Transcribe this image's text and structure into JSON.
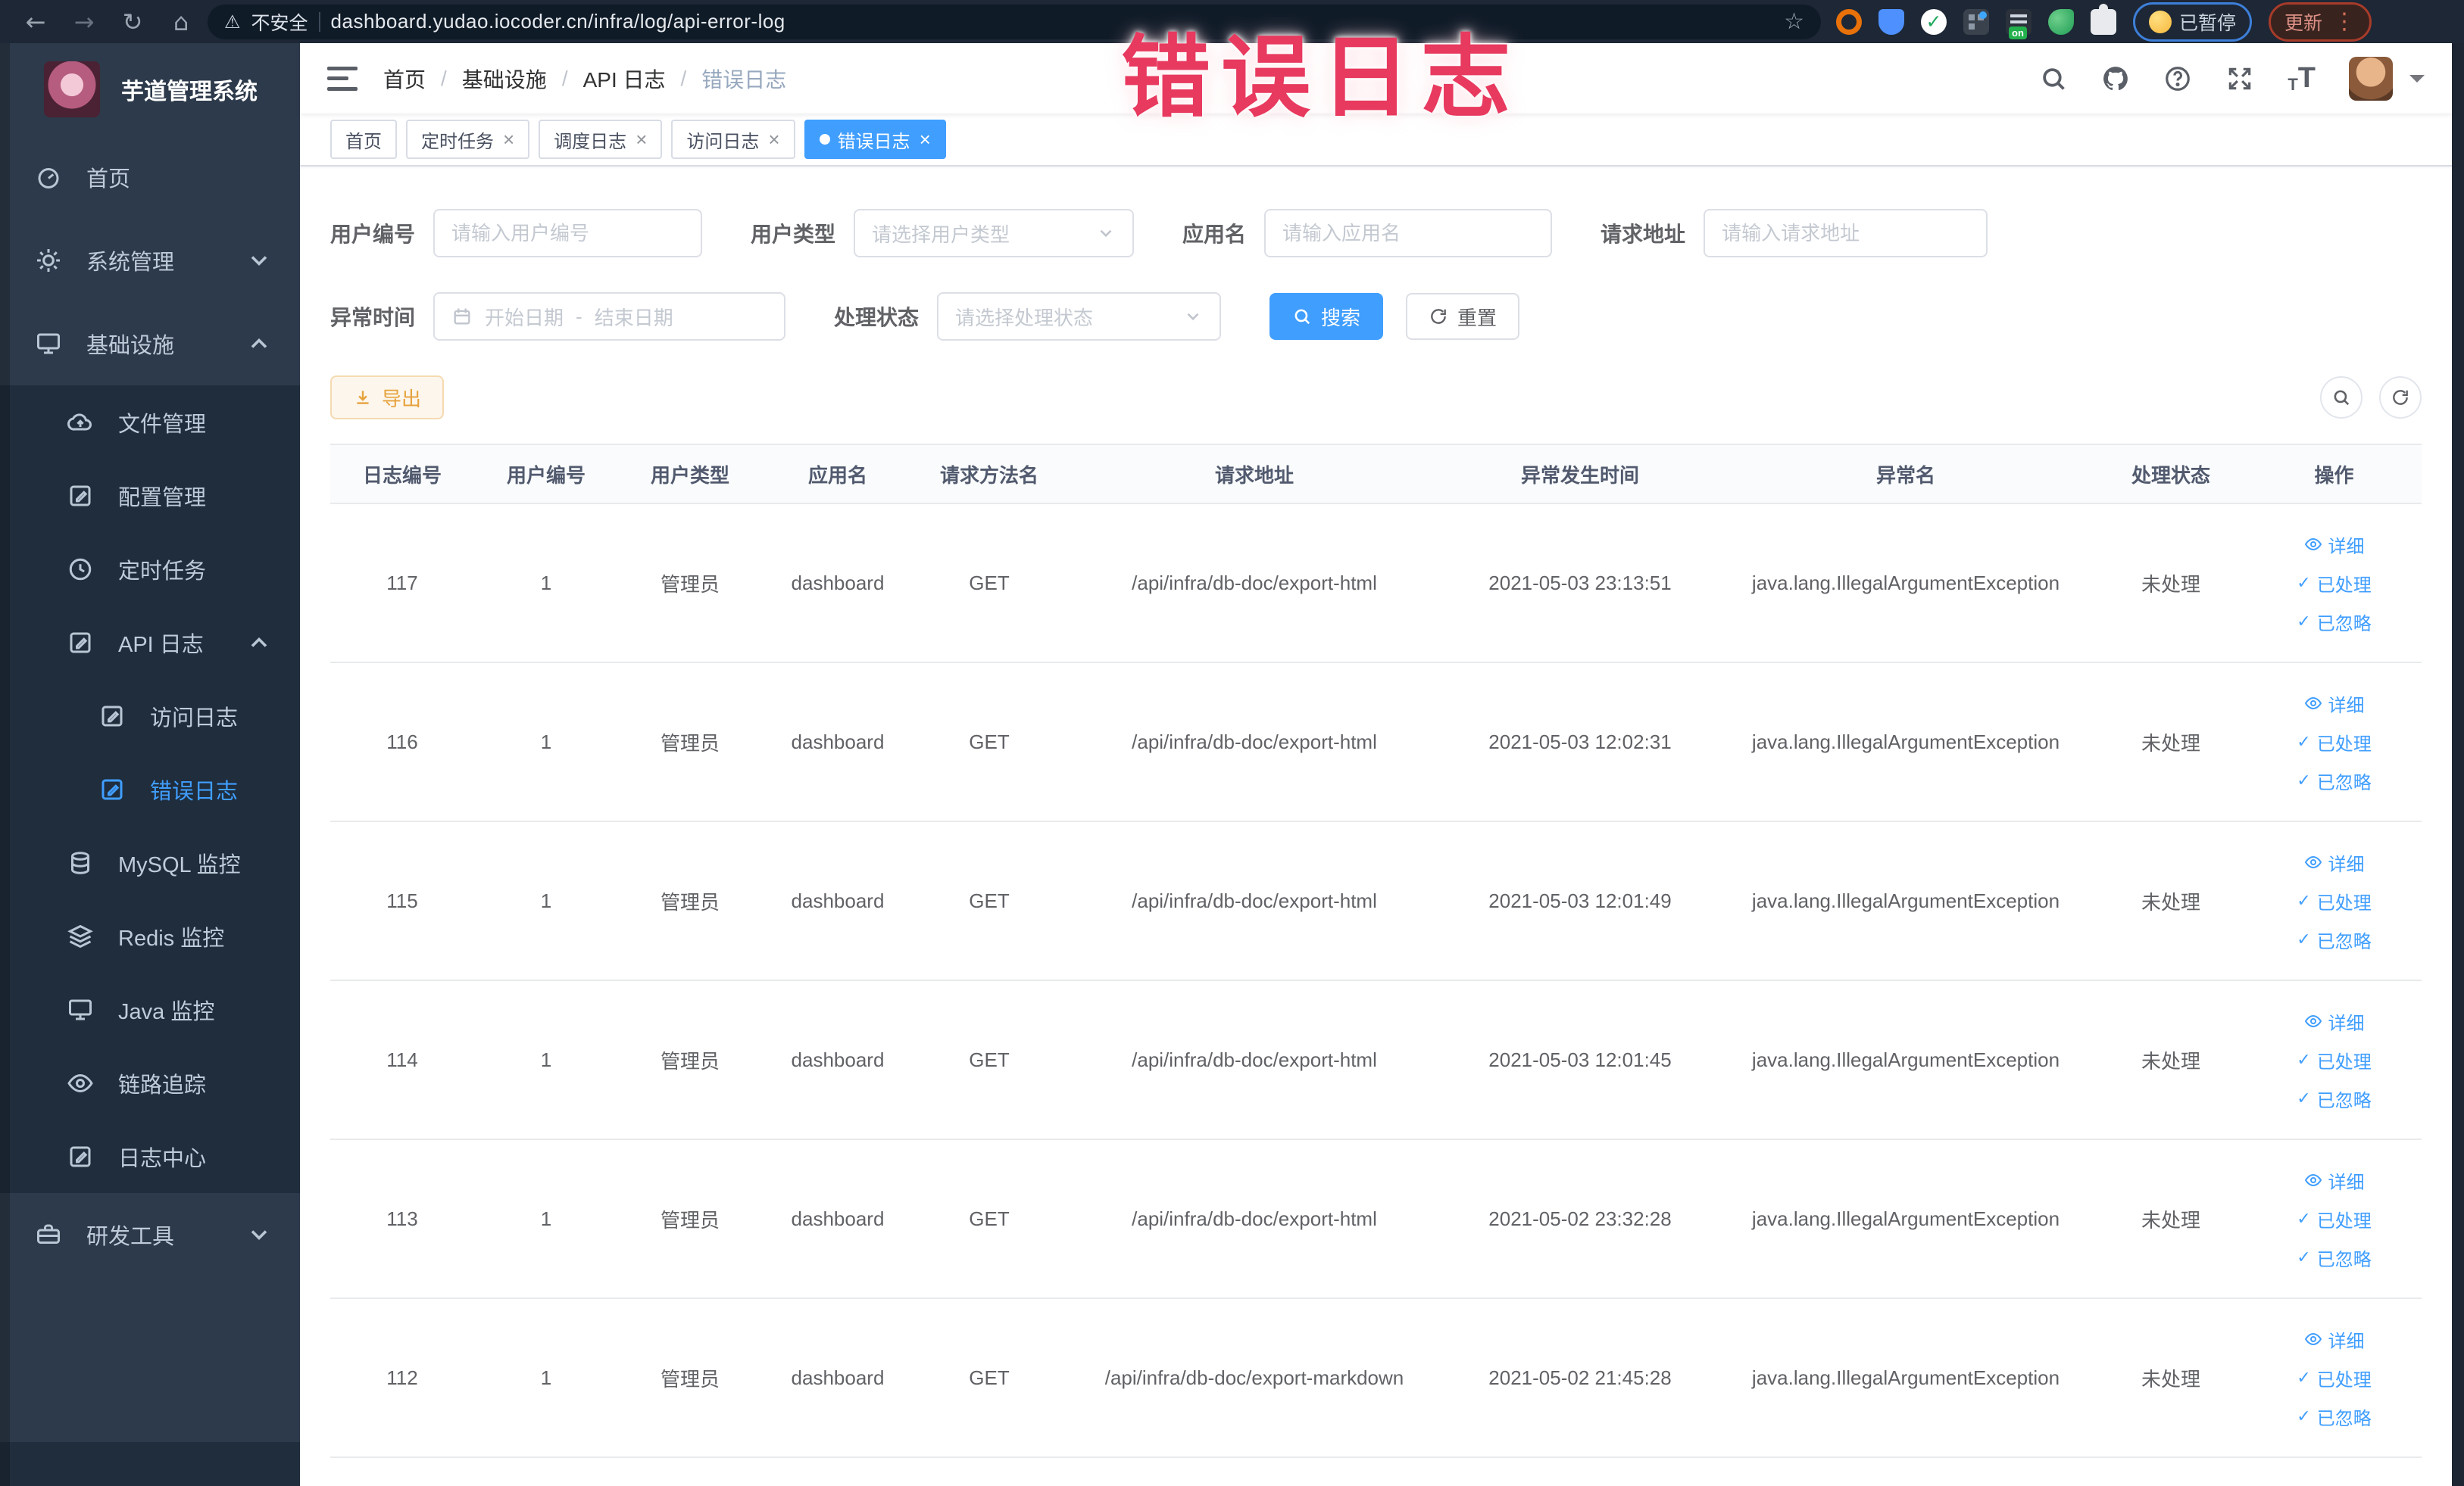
{
  "annotation": {
    "text": "错误日志"
  },
  "browser": {
    "security_label": "不安全",
    "url": "dashboard.yudao.iocoder.cn/infra/log/api-error-log",
    "extension_on_label": "on",
    "paused_badge": "已暂停",
    "update_badge": "更新",
    "icons": [
      "back-icon",
      "forward-icon",
      "refresh-icon",
      "home-icon",
      "warning-icon",
      "bookmark-star-icon",
      "kebab-menu-icon"
    ]
  },
  "sidebar": {
    "app_title": "芋道管理系统",
    "items": [
      {
        "label": "首页",
        "icon": "dashboard-icon"
      },
      {
        "label": "系统管理",
        "icon": "gear-icon",
        "chevron": "down"
      },
      {
        "label": "基础设施",
        "icon": "monitor-icon",
        "chevron": "up"
      },
      {
        "label": "文件管理",
        "icon": "cloud-upload-icon"
      },
      {
        "label": "配置管理",
        "icon": "edit-icon"
      },
      {
        "label": "定时任务",
        "icon": "clock-icon"
      },
      {
        "label": "API 日志",
        "icon": "log-icon",
        "chevron": "up"
      },
      {
        "label": "访问日志",
        "icon": "log-icon"
      },
      {
        "label": "错误日志",
        "icon": "log-icon",
        "active": true
      },
      {
        "label": "MySQL 监控",
        "icon": "database-icon"
      },
      {
        "label": "Redis 监控",
        "icon": "layers-icon"
      },
      {
        "label": "Java 监控",
        "icon": "java-monitor-icon"
      },
      {
        "label": "链路追踪",
        "icon": "eye-icon"
      },
      {
        "label": "日志中心",
        "icon": "log-center-icon"
      },
      {
        "label": "研发工具",
        "icon": "toolbox-icon",
        "chevron": "down"
      }
    ]
  },
  "header": {
    "breadcrumb": [
      "首页",
      "基础设施",
      "API 日志",
      "错误日志"
    ],
    "right_icons": [
      "search-icon",
      "github-icon",
      "help-icon",
      "fullscreen-icon",
      "font-size-icon",
      "avatar",
      "caret-down-icon"
    ]
  },
  "tabs": [
    {
      "label": "首页",
      "closable": false,
      "active": false
    },
    {
      "label": "定时任务",
      "closable": true,
      "active": false
    },
    {
      "label": "调度日志",
      "closable": true,
      "active": false
    },
    {
      "label": "访问日志",
      "closable": true,
      "active": false
    },
    {
      "label": "错误日志",
      "closable": true,
      "active": true
    }
  ],
  "filters": {
    "user_id_label": "用户编号",
    "user_id_placeholder": "请输入用户编号",
    "user_type_label": "用户类型",
    "user_type_placeholder": "请选择用户类型",
    "app_name_label": "应用名",
    "app_name_placeholder": "请输入应用名",
    "request_url_label": "请求地址",
    "request_url_placeholder": "请输入请求地址",
    "exception_time_label": "异常时间",
    "date_start_placeholder": "开始日期",
    "date_separator": "-",
    "date_end_placeholder": "结束日期",
    "process_status_label": "处理状态",
    "process_status_placeholder": "请选择处理状态",
    "search_button": "搜索",
    "reset_button": "重置"
  },
  "toolbar": {
    "export_button": "导出"
  },
  "table": {
    "columns": [
      "日志编号",
      "用户编号",
      "用户类型",
      "应用名",
      "请求方法名",
      "请求地址",
      "异常发生时间",
      "异常名",
      "处理状态",
      "操作"
    ],
    "row_actions": {
      "detail": "详细",
      "processed": "已处理",
      "ignored": "已忽略"
    },
    "rows": [
      {
        "id": "117",
        "user_id": "1",
        "user_type": "管理员",
        "app": "dashboard",
        "method": "GET",
        "url": "/api/infra/db-doc/export-html",
        "time": "2021-05-03 23:13:51",
        "exception": "java.lang.IllegalArgumentException",
        "status": "未处理"
      },
      {
        "id": "116",
        "user_id": "1",
        "user_type": "管理员",
        "app": "dashboard",
        "method": "GET",
        "url": "/api/infra/db-doc/export-html",
        "time": "2021-05-03 12:02:31",
        "exception": "java.lang.IllegalArgumentException",
        "status": "未处理"
      },
      {
        "id": "115",
        "user_id": "1",
        "user_type": "管理员",
        "app": "dashboard",
        "method": "GET",
        "url": "/api/infra/db-doc/export-html",
        "time": "2021-05-03 12:01:49",
        "exception": "java.lang.IllegalArgumentException",
        "status": "未处理"
      },
      {
        "id": "114",
        "user_id": "1",
        "user_type": "管理员",
        "app": "dashboard",
        "method": "GET",
        "url": "/api/infra/db-doc/export-html",
        "time": "2021-05-03 12:01:45",
        "exception": "java.lang.IllegalArgumentException",
        "status": "未处理"
      },
      {
        "id": "113",
        "user_id": "1",
        "user_type": "管理员",
        "app": "dashboard",
        "method": "GET",
        "url": "/api/infra/db-doc/export-html",
        "time": "2021-05-02 23:32:28",
        "exception": "java.lang.IllegalArgumentException",
        "status": "未处理"
      },
      {
        "id": "112",
        "user_id": "1",
        "user_type": "管理员",
        "app": "dashboard",
        "method": "GET",
        "url": "/api/infra/db-doc/export-markdown",
        "time": "2021-05-02 21:45:28",
        "exception": "java.lang.IllegalArgumentException",
        "status": "未处理"
      }
    ]
  },
  "colors": {
    "accent": "#409eff",
    "warning": "#e6a23c",
    "sidebar_bg": "#2d3a4b",
    "submenu_bg": "#1f2d3d",
    "tag_active": "#409eff",
    "annotation": "#e8395e"
  }
}
